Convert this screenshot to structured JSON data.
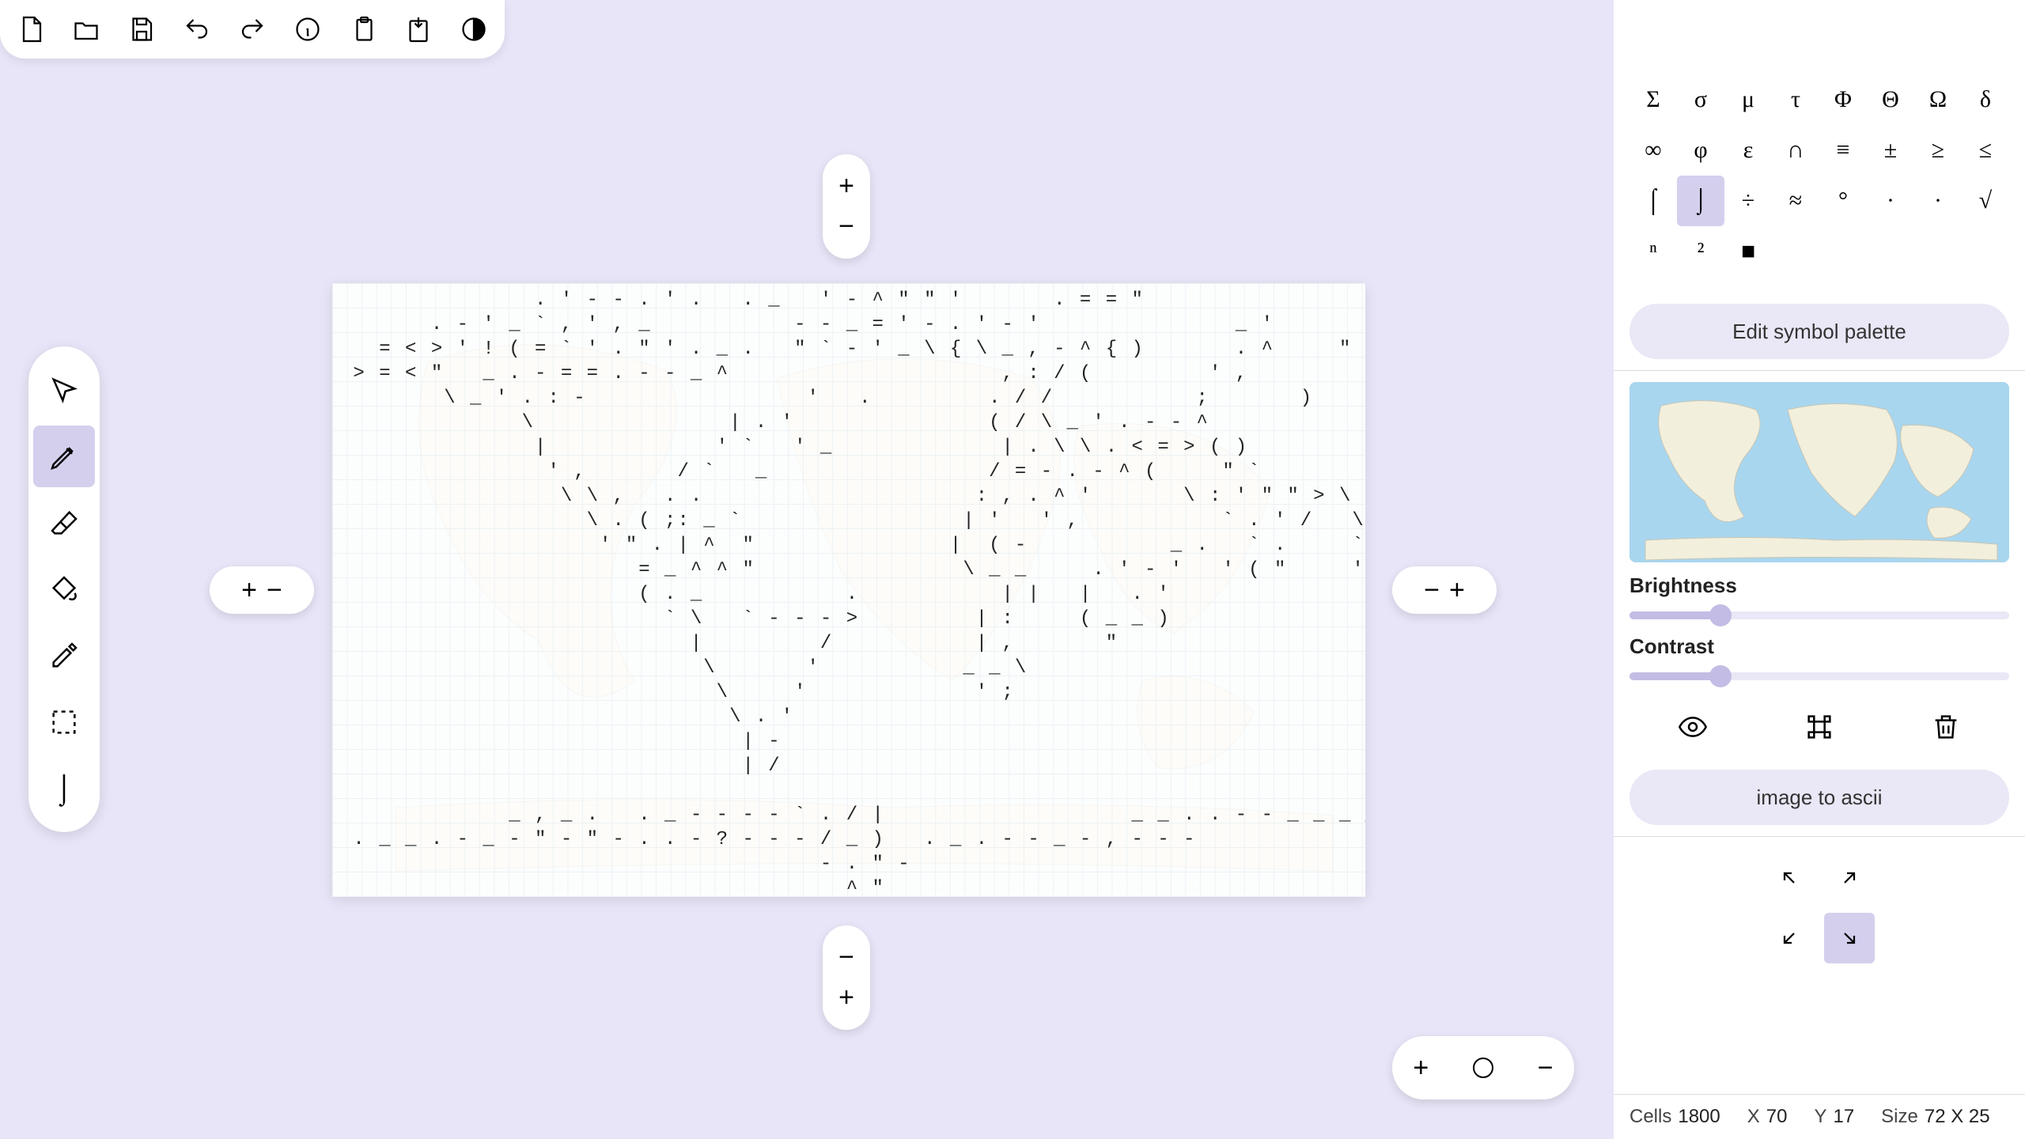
{
  "top_toolbar": {
    "items": [
      "new",
      "open",
      "save",
      "undo",
      "redo",
      "info",
      "paste",
      "export",
      "contrast"
    ]
  },
  "tools": {
    "items": [
      "pointer",
      "pencil",
      "eraser",
      "fill",
      "eyedropper",
      "marquee"
    ],
    "selected": "pencil",
    "current_char": "⌡"
  },
  "canvas_pills": {
    "plus": "+",
    "minus": "−"
  },
  "zoom": {
    "plus": "+",
    "minus": "−"
  },
  "symbols": {
    "rows": [
      "Σ",
      "σ",
      "μ",
      "τ",
      "Φ",
      "Θ",
      "Ω",
      "δ",
      "∞",
      "φ",
      "ε",
      "∩",
      "≡",
      "±",
      "≥",
      "≤",
      "⌠",
      "⌡",
      "÷",
      "≈",
      "°",
      "∙",
      "·",
      "√",
      "ⁿ",
      "²",
      "■"
    ],
    "selected_index": 17
  },
  "panel": {
    "edit_palette_label": "Edit symbol palette",
    "brightness_label": "Brightness",
    "brightness_pct": 24,
    "contrast_label": "Contrast",
    "contrast_pct": 24,
    "image_to_ascii_label": "image to ascii"
  },
  "direction": {
    "selected": "se"
  },
  "status": {
    "cells_label": "Cells",
    "cells_value": "1800",
    "x_label": "X",
    "x_value": "70",
    "y_label": "Y",
    "y_value": "17",
    "size_label": "Size",
    "size_value": "72 X 25"
  },
  "ascii_art": "               . ' - - . ' .   . _   ' - ^ \" \" '       . = = \"                   .         . - - - . ,        \n       . - ' _ ` , ' , _           - - _ = ' - . ' - '               _ '       ^ ^ '   - - \" - -     _ .  ` \n   = < > ' ! ( = ` ' . \" ' . _ .   \" ` - ' _ \\ { \\ _ , - ^ { )       . ^     \" '   \" \" \" \" ` _ - - _ - _ '  \n > = < \"   _ . - = = . - - _ ^                     , : / (         ' ,                 \"   \\   ' |\n        \\ _ ' . : -                 '   .         . / /           ;       )                 \" . \\ . ( |\n              \\               | . '               ( / \\ _ ' . - - ^                       . . ' \\ / /\n               |             ' `   ' _             | . \\ \\ . < = > ( )                   | ' } = / )\n                ' ,       / `   _                 / = - . - ^ (     \" `                 . / /  ' /\n                 \\ \\ ,   . .                     : , . ^ '       \\ : ' \" \" > \\           ' :\n                   \\ . ( ;: _ `                 | '   ' ,           ` . ' /   \\ /           ' : .\n                    ' \" . | ^  \"               |  ( -           _ .   ` .     ` _           ' _ .\n                       = _ ^ ^ \"                \\ _ _     . ' - '   ' ( \"     ' \\ , . ;       \\ .\n                       ( . _           .           | |   |   . '               \\ < _ | h - . . ,\n                         ` \\   ` - - - >         | :     ( _ _ )                 | _         - _ \\\n                           |         /           | ,       \"                     ' , .        .  )\n                            \\       '           _ _ \\                               \"       _ \" \\\n                             \\     '             ' ;                                   \" . . , - - . '\n                              \\ . '                                                     \\ _ ) ` . -\n                               | -                                                               \" \" '\n                               | /\n                                                                                                       _\n             _ , _ .   . _ - - - - ` . / |                   _ _ . . - - _ _ _ _ - - . . _ _ . _ _ - -   >\n . _ _ . - _ - \" - \" - . . - ? - - - / _ )   . _ . - - _ - , - - -                                 < ' _ - -\n                                     - . \" -                                                       ` -\n                                       ^ \""
}
